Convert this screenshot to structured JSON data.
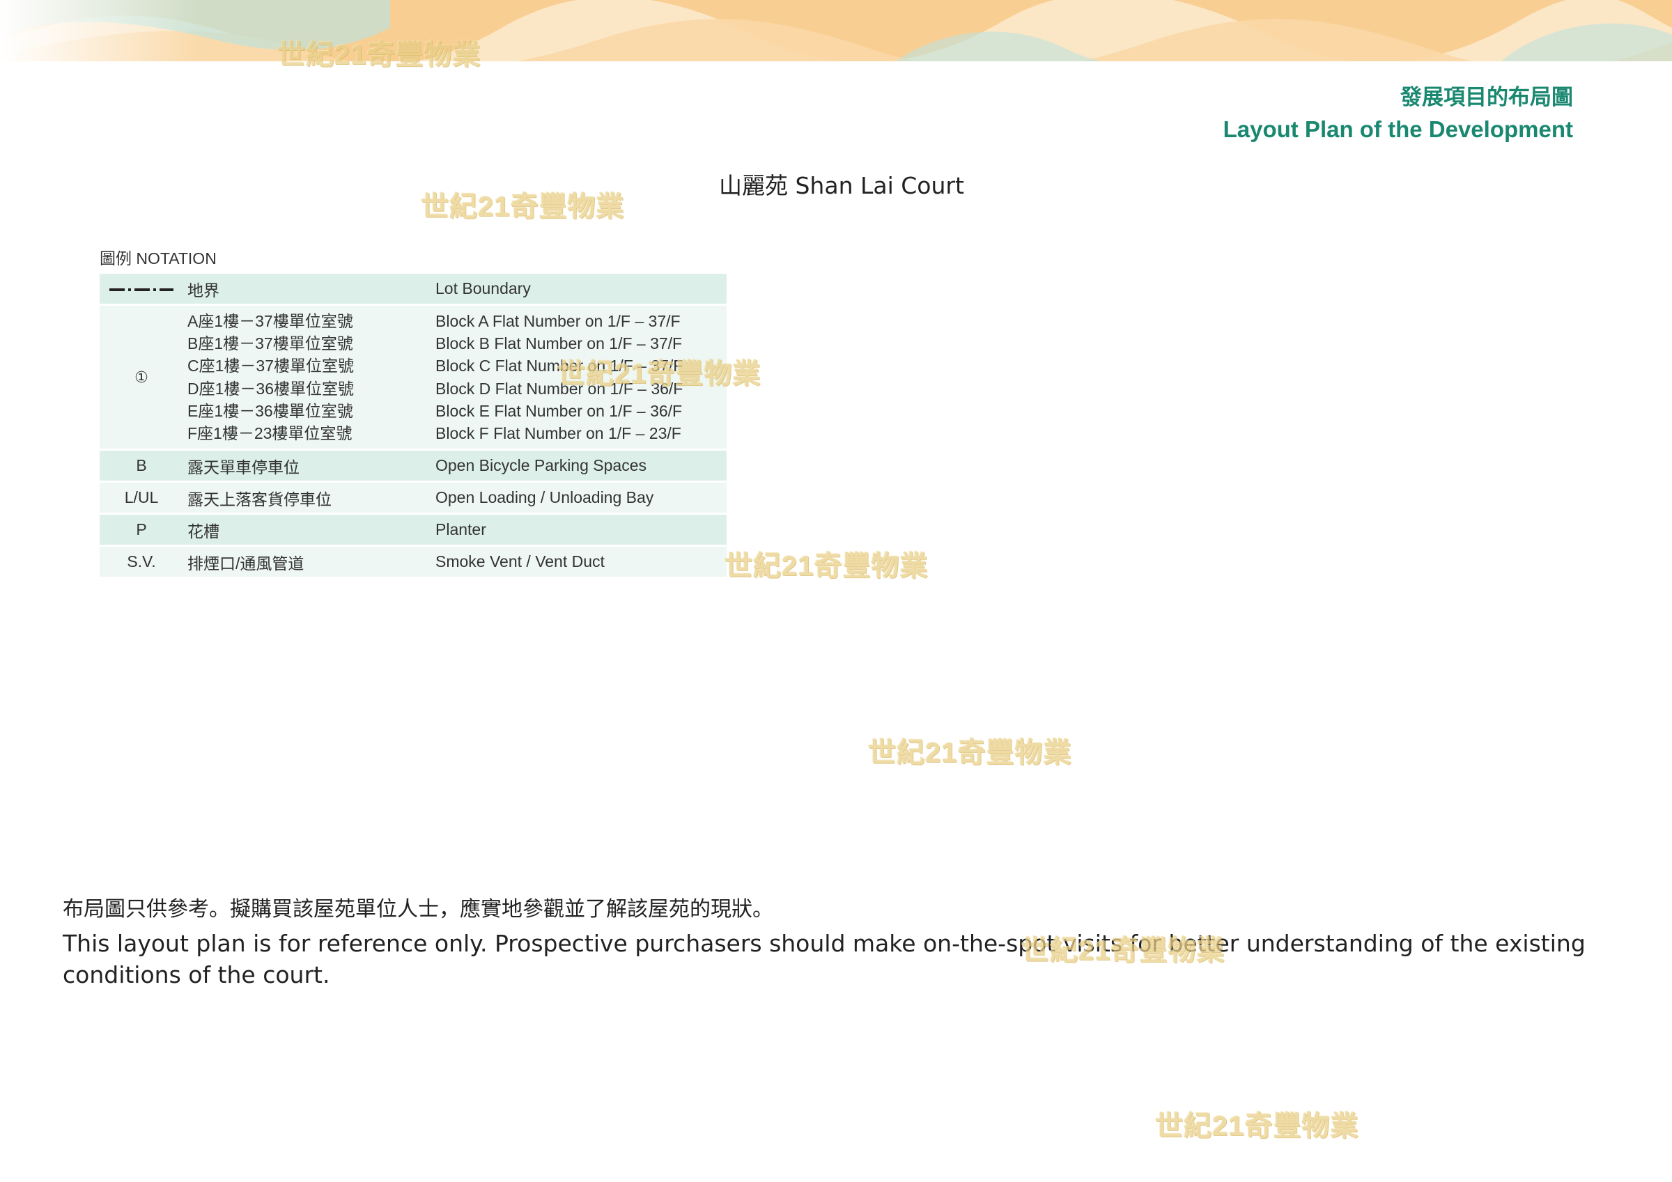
{
  "header": {
    "title_zh": "發展項目的布局圖",
    "title_en": "Layout Plan of the Development"
  },
  "court_title": "山麗苑 Shan Lai Court",
  "notation": {
    "title": "圖例 NOTATION",
    "rows": [
      {
        "symbol": "",
        "symbol_icon": "dash-dot-line",
        "zh": "地界",
        "en": "Lot Boundary"
      },
      {
        "symbol": "①",
        "zh_lines": [
          "A座1樓－37樓單位室號",
          "B座1樓－37樓單位室號",
          "C座1樓－37樓單位室號",
          "D座1樓－36樓單位室號",
          "E座1樓－36樓單位室號",
          "F座1樓－23樓單位室號"
        ],
        "en_lines": [
          "Block A Flat Number on 1/F – 37/F",
          "Block B Flat Number on 1/F – 37/F",
          "Block C Flat Number on 1/F – 37/F",
          "Block D Flat Number on 1/F – 36/F",
          "Block E Flat Number on 1/F – 36/F",
          "Block F Flat Number on 1/F – 23/F"
        ]
      },
      {
        "symbol": "B",
        "zh": "露天單車停車位",
        "en": "Open Bicycle Parking Spaces"
      },
      {
        "symbol": "L/UL",
        "zh": "露天上落客貨停車位",
        "en": "Open Loading / Unloading Bay"
      },
      {
        "symbol": "P",
        "zh": "花槽",
        "en": "Planter"
      },
      {
        "symbol": "S.V.",
        "zh": "排煙口/通風管道",
        "en": "Smoke Vent / Vent Duct"
      }
    ]
  },
  "disclaimer": {
    "zh": "布局圖只供參考。擬購買該屋苑單位人士，應實地參觀並了解該屋苑的現狀。",
    "en": "This layout plan is for reference only.  Prospective purchasers should make on-the-spot visits for better understanding of the existing conditions of the court."
  },
  "watermark_text": "世紀21奇豐物業",
  "colors": {
    "heading": "#1a8870",
    "legend_dark": "#dcefe8",
    "legend_light": "#eef7f3",
    "wave_orange": "#f7c98a",
    "wave_teal": "#bfe3dc"
  }
}
